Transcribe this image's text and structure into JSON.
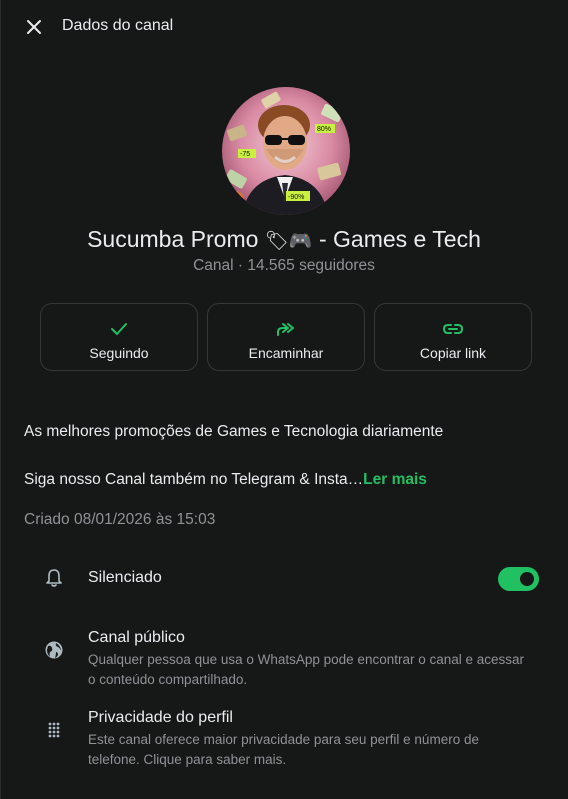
{
  "header": {
    "title": "Dados do canal",
    "close_icon": "close-icon"
  },
  "channel": {
    "name_prefix": "Sucumba Promo ",
    "name_emoji": "🏷🎮",
    "name_suffix": " - Games e Tech",
    "subtitle": "Canal · 14.565 seguidores",
    "avatar_tags": [
      "-75",
      "80%",
      "-90%"
    ]
  },
  "actions": [
    {
      "label": "Seguindo",
      "icon": "check-icon"
    },
    {
      "label": "Encaminhar",
      "icon": "forward-icon"
    },
    {
      "label": "Copiar link",
      "icon": "link-icon"
    }
  ],
  "description": {
    "line1": "As melhores promoções de Games e Tecnologia diariamente",
    "line2": "Siga nosso Canal também no Telegram & Insta…",
    "read_more": "Ler mais"
  },
  "created": "Criado 08/01/2026 às 15:03",
  "settings": {
    "muted": {
      "label": "Silenciado",
      "enabled": true,
      "icon": "bell-icon"
    },
    "public": {
      "title": "Canal público",
      "text": "Qualquer pessoa que usa o WhatsApp pode encontrar o canal e acessar o conteúdo compartilhado.",
      "icon": "globe-icon"
    },
    "privacy": {
      "title": "Privacidade do perfil",
      "text": "Este canal oferece maior privacidade para seu perfil e número de telefone. Clique para saber mais.",
      "icon": "dots-grid-icon"
    }
  },
  "colors": {
    "background": "#161717",
    "accent": "#21c063",
    "text_primary": "#e9edef",
    "text_secondary": "#8f9396",
    "border": "#34373a"
  }
}
